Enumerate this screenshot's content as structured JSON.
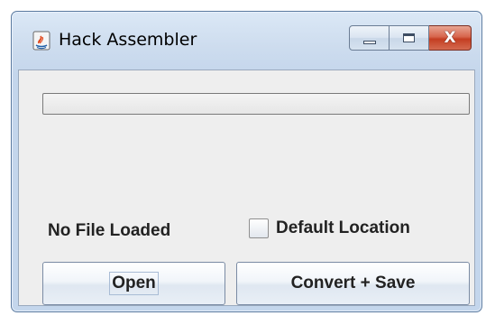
{
  "window": {
    "title": "Hack Assembler",
    "app_icon": "java-icon",
    "caption_icons": {
      "minimize": "minimize-icon",
      "maximize": "maximize-icon",
      "close": "close-icon"
    },
    "close_glyph": "X"
  },
  "progress": {
    "value": 0
  },
  "status": {
    "text": "No File Loaded"
  },
  "options": {
    "default_location": {
      "label": "Default Location",
      "checked": false
    }
  },
  "buttons": {
    "open_label": "Open",
    "convert_save_label": "Convert + Save"
  },
  "colors": {
    "close_button": "#c9432a",
    "client_background": "#eeeeee"
  }
}
